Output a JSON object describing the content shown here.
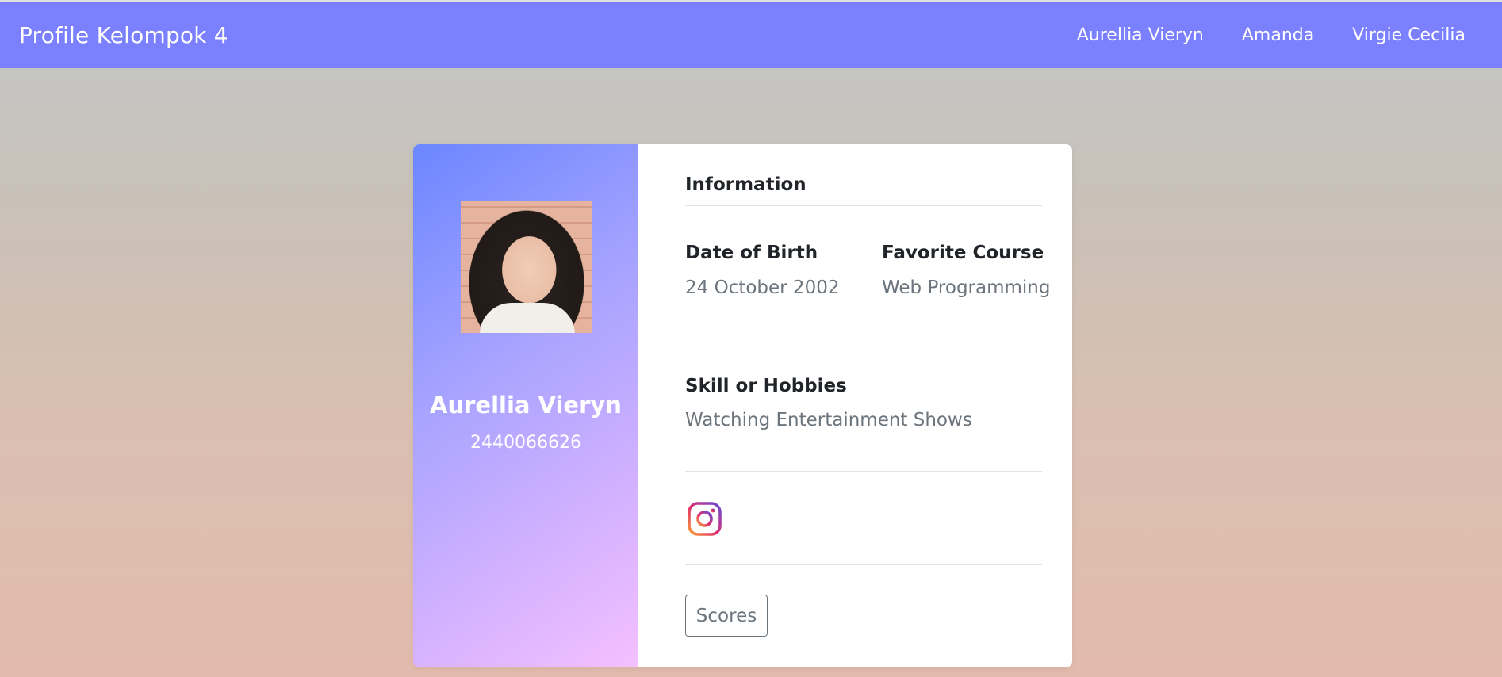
{
  "navbar": {
    "brand": "Profile Kelompok 4",
    "links": [
      "Aurellia Vieryn",
      "Amanda",
      "Virgie Cecilia"
    ]
  },
  "profile": {
    "name": "Aurellia Vieryn",
    "id": "2440066626"
  },
  "info": {
    "title": "Information",
    "dob_label": "Date of Birth",
    "dob_value": "24 October 2002",
    "course_label": "Favorite Course",
    "course_value": "Web Programming",
    "skill_label": "Skill or Hobbies",
    "skill_value": "Watching Entertainment Shows"
  },
  "social": {
    "icon": "instagram-icon"
  },
  "buttons": {
    "scores": "Scores"
  },
  "colors": {
    "navbar": "#7b80ff",
    "card_gradient_start": "#6b86ff",
    "card_gradient_end": "#f4c0ff",
    "muted_text": "#6c757d"
  }
}
